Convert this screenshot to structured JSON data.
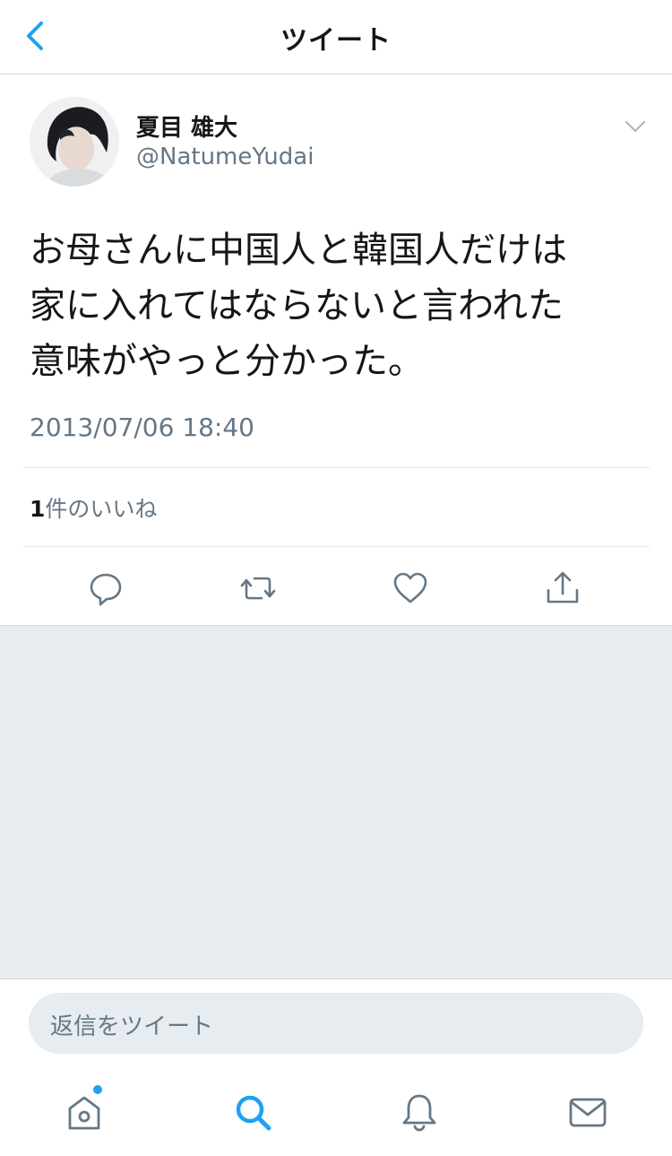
{
  "header": {
    "title": "ツイート"
  },
  "author": {
    "name": "夏目 雄大",
    "handle": "@NatumeYudai"
  },
  "tweet": {
    "lines": [
      "お母さんに中国人と韓国人だけは",
      "家に入れてはならないと言われた",
      "意味がやっと分かった。"
    ],
    "timestamp": "2013/07/06 18:40"
  },
  "stats": {
    "like_count": "1",
    "like_label": "件のいいね"
  },
  "reply": {
    "placeholder": "返信をツイート"
  },
  "icons": {
    "back": "chevron-left-icon",
    "menu": "chevron-down-icon",
    "reply": "reply-icon",
    "retweet": "retweet-icon",
    "like": "heart-icon",
    "share": "share-icon",
    "home": "home-icon",
    "search": "search-icon",
    "notifications": "bell-icon",
    "messages": "envelope-icon"
  },
  "colors": {
    "accent": "#1da1f2",
    "secondary_text": "#657786",
    "icon_gray": "#657786"
  }
}
